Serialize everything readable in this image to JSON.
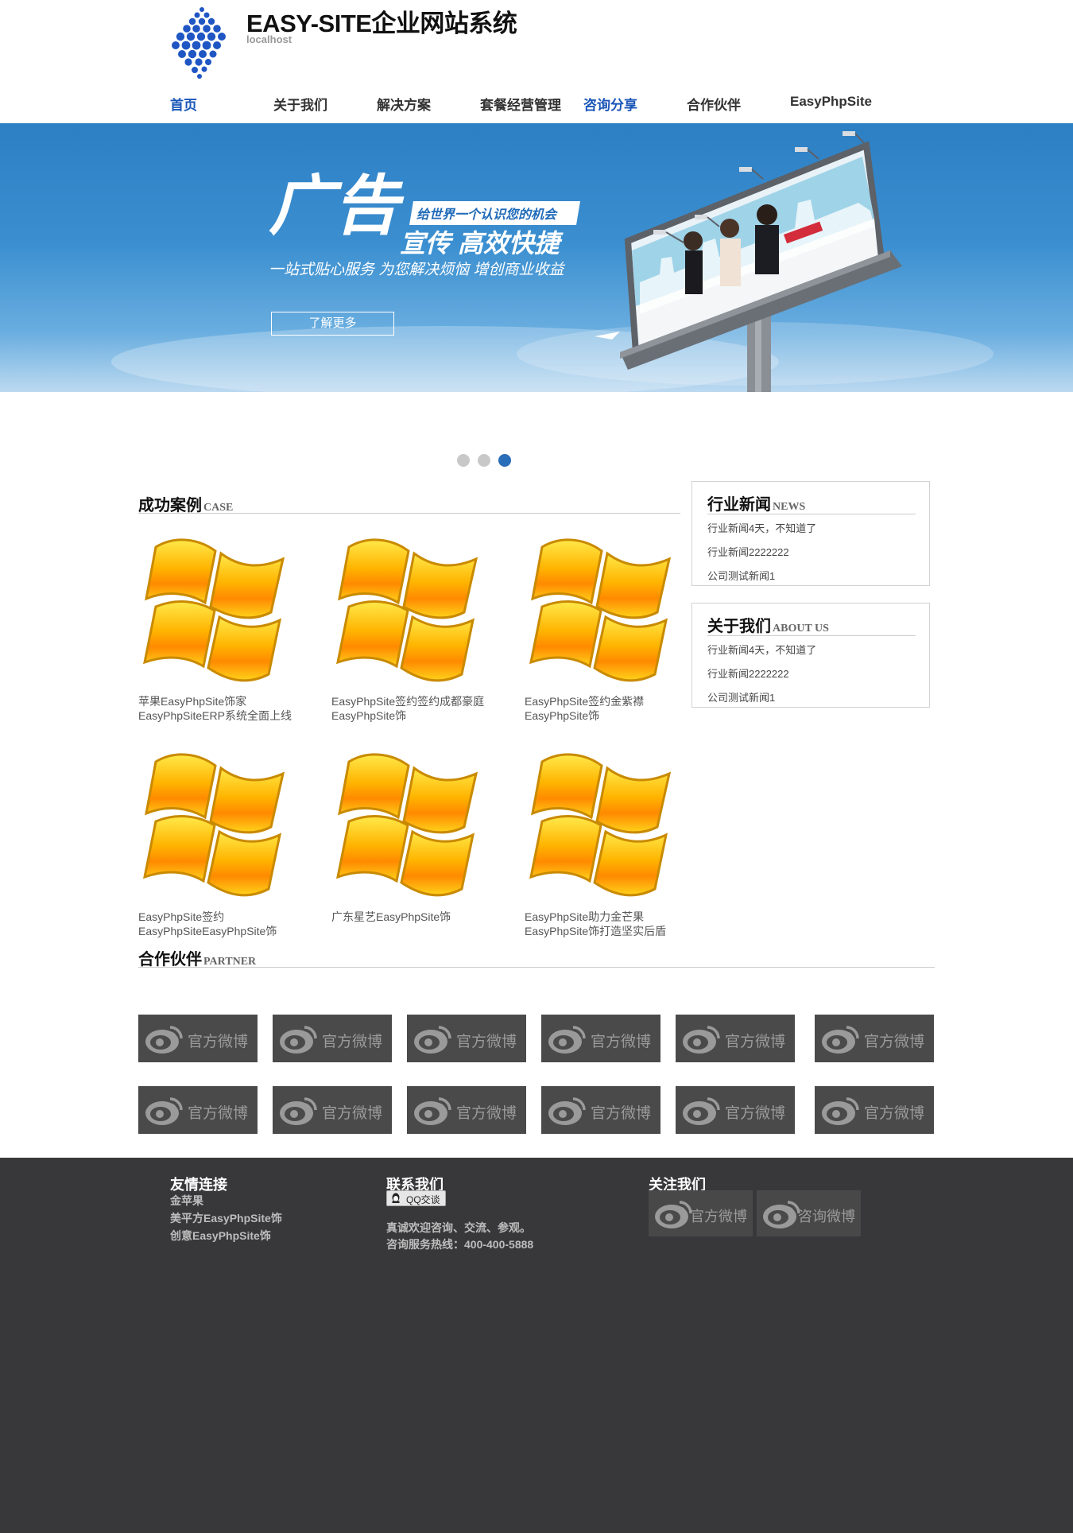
{
  "header": {
    "title": "EASY-SITE企业网站系统",
    "subtitle": "localhost"
  },
  "nav": {
    "items": [
      {
        "label": "首页"
      },
      {
        "label": "关于我们"
      },
      {
        "label": "解决方案"
      },
      {
        "label": "套餐经营管理"
      },
      {
        "label": "咨询分享"
      },
      {
        "label": "合作伙伴"
      },
      {
        "label": "EasyPhpSite"
      }
    ]
  },
  "banner": {
    "headline_big": "广告",
    "tag": "给世界一个认识您的机会",
    "headline_2": "宣传 高效快捷",
    "slogan": "一站式贴心服务  为您解决烦恼  增创商业收益",
    "button_label": "了解更多"
  },
  "slider": {
    "active_index": 3,
    "count": 3
  },
  "cases": {
    "title": "成功案例",
    "title_en": "CASE",
    "items": [
      {
        "title": "苹果EasyPhpSite饰家EasyPhpSiteERP系统全面上线"
      },
      {
        "title": "EasyPhpSite签约签约成都豪庭EasyPhpSite饰"
      },
      {
        "title": "EasyPhpSite签约金紫襟EasyPhpSite饰"
      },
      {
        "title": "EasyPhpSite签约EasyPhpSiteEasyPhpSite饰"
      },
      {
        "title": "广东星艺EasyPhpSite饰"
      },
      {
        "title": "EasyPhpSite助力金芒果EasyPhpSite饰打造坚实后盾"
      }
    ]
  },
  "news": {
    "title": "行业新闻",
    "title_en": "NEWS",
    "items": [
      "行业新闻4天，不知道了",
      "行业新闻2222222",
      "公司测试新闻1"
    ]
  },
  "about": {
    "title": "关于我们",
    "title_en": "ABOUT US",
    "items": [
      "行业新闻4天，不知道了",
      "行业新闻2222222",
      "公司测试新闻1"
    ]
  },
  "partners": {
    "title": "合作伙伴",
    "title_en": "PARTNER",
    "logo_label": "官方微博"
  },
  "footer": {
    "links_title": "友情连接",
    "links": [
      "金苹果",
      "美平方EasyPhpSite饰",
      "创意EasyPhpSite饰"
    ],
    "contact_title": "联系我们",
    "qq_label": "QQ交谈",
    "contact_line1": "真诚欢迎咨询、交流、参观。",
    "contact_line2": "咨询服务热线：400-400-5888",
    "follow_title": "关注我们",
    "follow_buttons": [
      "官方微博",
      "咨询微博"
    ]
  },
  "colors": {
    "accent": "#1a56b8",
    "banner_blue": "#2d7fc4",
    "footer_bg": "#38383b",
    "weibo_tile": "#4a4a4a"
  },
  "icons": [
    "logo-mark",
    "windows-logo-icon",
    "weibo-icon",
    "qq-icon"
  ]
}
